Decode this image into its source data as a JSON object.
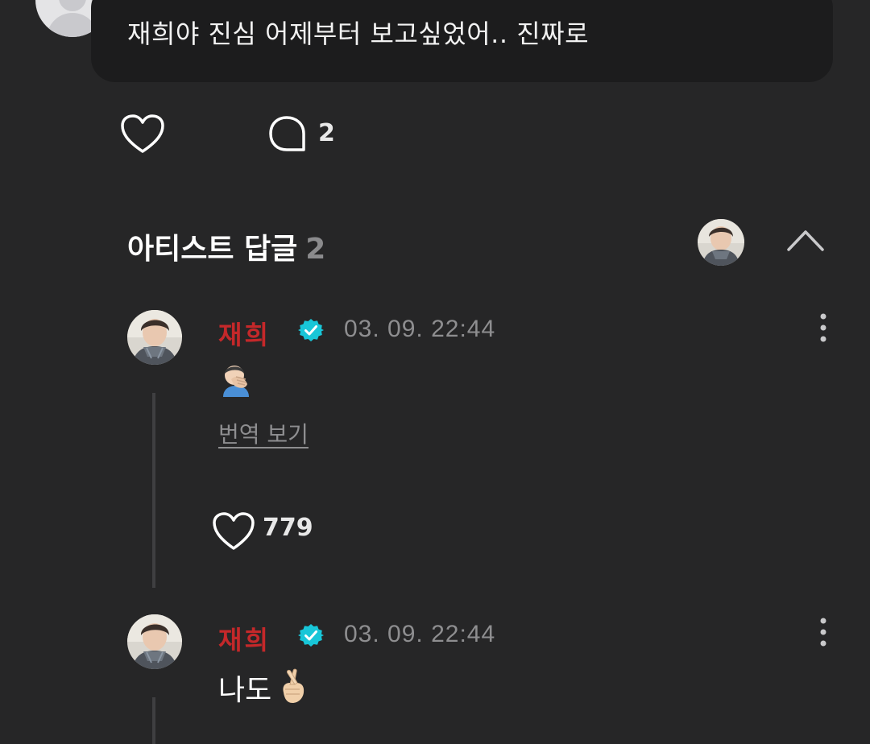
{
  "comment": {
    "text": "재희야 진심 어제부터 보고싶었어.. 진짜로",
    "reply_count": "2"
  },
  "artist_replies": {
    "title": "아티스트 답글",
    "count": "2",
    "replies": [
      {
        "name": "재희",
        "timestamp": "03. 09. 22:44",
        "text": "",
        "emoji": "facepalm",
        "translate_label": "번역 보기",
        "like_count": "779"
      },
      {
        "name": "재희",
        "timestamp": "03. 09. 22:44",
        "text": "나도",
        "emoji": "crossed-fingers"
      }
    ]
  },
  "colors": {
    "background": "#262627",
    "bubble": "#1c1c1d",
    "artist_name": "#c4282a",
    "verified_badge": "#18c6d8",
    "muted_text": "#8e8e90"
  },
  "icons": [
    "heart-icon",
    "comment-icon",
    "chevron-up-icon",
    "verified-badge-icon",
    "more-vertical-icon"
  ]
}
